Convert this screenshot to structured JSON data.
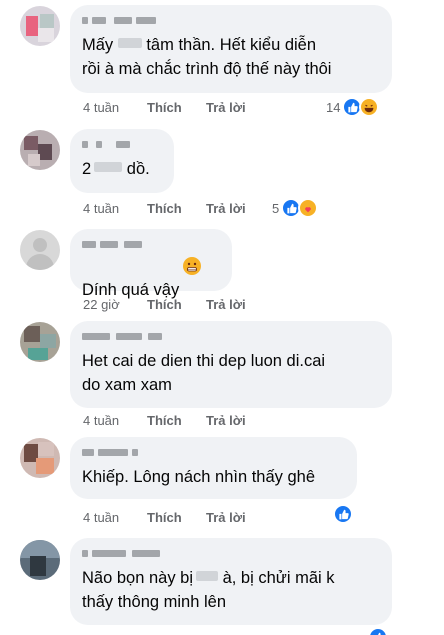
{
  "comments": [
    {
      "text_before": "Mấy ",
      "text_after": " tâm thần. Hết kiểu diễn\nrồi à mà chắc trình độ thế này thôi",
      "time": "4 tuần",
      "like": "Thích",
      "reply": "Trả lời",
      "reaction_count": "14",
      "reactions": [
        "like-icon",
        "haha-icon"
      ]
    },
    {
      "text_before": "2",
      "text_after": " dồ.",
      "time": "4 tuần",
      "like": "Thích",
      "reply": "Trả lời",
      "reaction_count": "5",
      "reactions": [
        "like-icon",
        "care-icon"
      ]
    },
    {
      "text_before": "Dính quá vậy",
      "text_after": "",
      "time": "22 giờ",
      "like": "Thích",
      "reply": "Trả lời",
      "reaction_count": "",
      "reactions": [],
      "inline_emoji": "grimace-emoji"
    },
    {
      "text_before": "Het cai de dien thi dep luon di.cai\ndo xam xam",
      "text_after": "",
      "time": "4 tuần",
      "like": "Thích",
      "reply": "Trả lời",
      "reaction_count": "",
      "reactions": []
    },
    {
      "text_before": "Khiếp. Lông nách nhìn thấy ghê",
      "text_after": "",
      "time": "4 tuần",
      "like": "Thích",
      "reply": "Trả lời",
      "reaction_count": "",
      "reactions": [
        "like-icon"
      ]
    },
    {
      "text_before": "Não bọn này bị",
      "text_after": " à, bị chửi mãi k\nthấy thông minh lên",
      "time": "",
      "like": "",
      "reply": "",
      "reaction_count": "",
      "reactions": [
        "like-icon"
      ]
    }
  ],
  "colors": {
    "bubble": "#f0f2f5",
    "meta_text": "#65676b",
    "like_blue": "#1877f2",
    "emoji_yellow": "#f7b125"
  }
}
